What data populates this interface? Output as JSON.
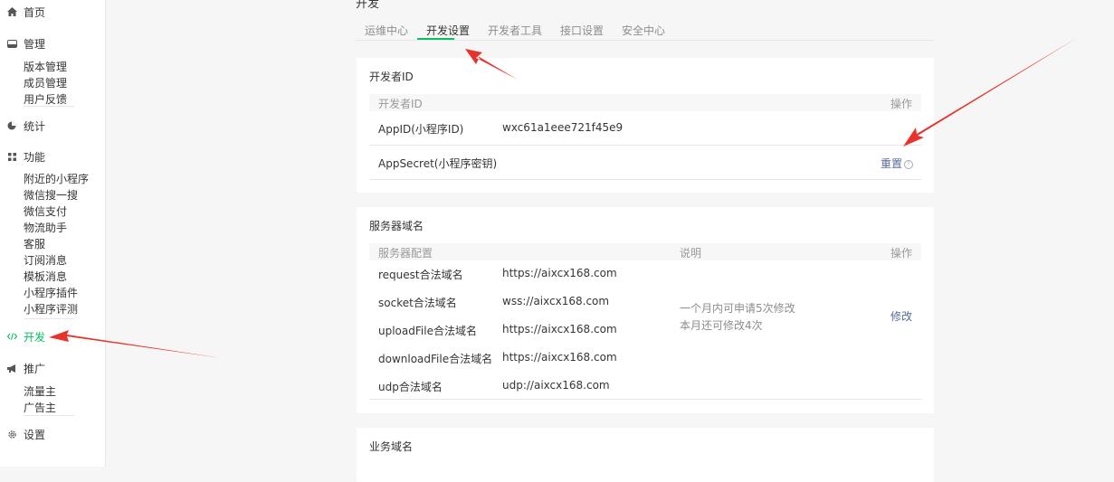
{
  "sidebar": {
    "home": {
      "label": "首页",
      "icon": "home-icon"
    },
    "manage": {
      "label": "管理",
      "icon": "manage-icon",
      "items": [
        "版本管理",
        "成员管理",
        "用户反馈"
      ]
    },
    "stats": {
      "label": "统计",
      "icon": "pie-chart-icon"
    },
    "features": {
      "label": "功能",
      "icon": "grid-icon",
      "items": [
        "附近的小程序",
        "微信搜一搜",
        "微信支付",
        "物流助手",
        "客服",
        "订阅消息",
        "模板消息",
        "小程序插件",
        "小程序评测"
      ]
    },
    "develop": {
      "label": "开发",
      "icon": "code-icon"
    },
    "promote": {
      "label": "推广",
      "icon": "megaphone-icon",
      "items": [
        "流量主",
        "广告主"
      ]
    },
    "settings": {
      "label": "设置",
      "icon": "gear-icon"
    }
  },
  "page": {
    "title": "开发"
  },
  "tabs": [
    "运维中心",
    "开发设置",
    "开发者工具",
    "接口设置",
    "安全中心"
  ],
  "dev_id": {
    "title": "开发者ID",
    "col_name": "开发者ID",
    "col_action": "操作",
    "appid_label": "AppID(小程序ID)",
    "appid_value": "wxc61a1eee721f45e9",
    "secret_label": "AppSecret(小程序密钥)",
    "reset_label": "重置",
    "help_icon": "?"
  },
  "server": {
    "title": "服务器域名",
    "col_config": "服务器配置",
    "col_desc": "说明",
    "col_action": "操作",
    "rows": [
      {
        "label": "request合法域名",
        "value": "https://aixcx168.com"
      },
      {
        "label": "socket合法域名",
        "value": "wss://aixcx168.com"
      },
      {
        "label": "uploadFile合法域名",
        "value": "https://aixcx168.com"
      },
      {
        "label": "downloadFile合法域名",
        "value": "https://aixcx168.com"
      },
      {
        "label": "udp合法域名",
        "value": "udp://aixcx168.com"
      }
    ],
    "desc_line1": "一个月内可申请5次修改",
    "desc_line2": "本月还可修改4次",
    "modify_label": "修改"
  },
  "business": {
    "title": "业务域名"
  },
  "colors": {
    "accent": "#07c160",
    "link": "#576b95",
    "arrow": "#e8322b"
  }
}
